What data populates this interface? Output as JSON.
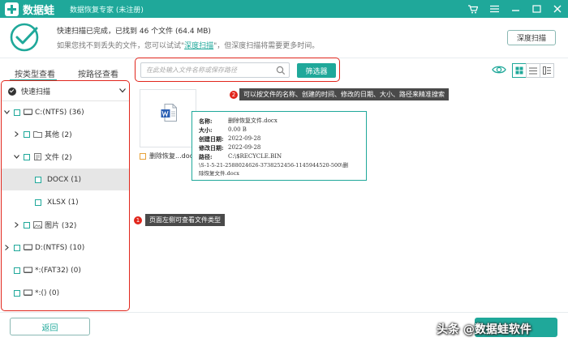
{
  "app": {
    "name": "数据蛙",
    "subtitle": "数据恢复专家 (未注册)"
  },
  "status": {
    "line1": "快速扫描已完成，已找到 46 个文件 (64.4 MB)",
    "line2_prefix": "如果您找不到丢失的文件，您可以试试\"",
    "line2_link": "深度扫描",
    "line2_suffix": "\"，但深度扫描将需要更多时间。",
    "deep_scan_button": "深度扫描"
  },
  "view_tabs": [
    "按类型查看",
    "按路径查看"
  ],
  "search": {
    "placeholder": "在此处输入文件名称或保存路径",
    "value": ""
  },
  "filter_button": "筛选器",
  "tree": {
    "quick_scan": "快速扫描",
    "items": [
      {
        "label": "C:(NTFS) (36)",
        "level": 0
      },
      {
        "label": "其他 (2)",
        "level": 1
      },
      {
        "label": "文件 (2)",
        "level": 1
      },
      {
        "label": "DOCX (1)",
        "level": 2
      },
      {
        "label": "XLSX (1)",
        "level": 2
      },
      {
        "label": "图片 (32)",
        "level": 1
      },
      {
        "label": "D:(NTFS) (10)",
        "level": 0
      },
      {
        "label": "*:(FAT32) (0)",
        "level": 0
      },
      {
        "label": "*:() (0)",
        "level": 0
      }
    ]
  },
  "file_card": {
    "name": "删除恢复...docx"
  },
  "tooltip": {
    "rows": [
      {
        "key": "名称:",
        "value": "删除恢复文件.docx"
      },
      {
        "key": "大小:",
        "value": "0.00 B"
      },
      {
        "key": "创建日期:",
        "value": "2022-09-28"
      },
      {
        "key": "修改日期:",
        "value": "2022-09-28"
      },
      {
        "key": "路径:",
        "value": "C:\\$RECYCLE.BIN"
      }
    ],
    "path_line2": "\\S-1-5-21-2588024626-3738252456-1145944520-500\\删",
    "path_line3": "除恢复文件.docx"
  },
  "annotations": [
    {
      "num": "2",
      "text": "可以按文件的名称、创建的时间、修改的日期、大小、路径来精准搜索"
    },
    {
      "num": "1",
      "text": "页面左侧可查看文件类型"
    }
  ],
  "back_button": "返回",
  "watermark": "头条 @数据蛙软件",
  "colors": {
    "accent": "#1fa89a",
    "annotation_red": "#e1261c"
  }
}
